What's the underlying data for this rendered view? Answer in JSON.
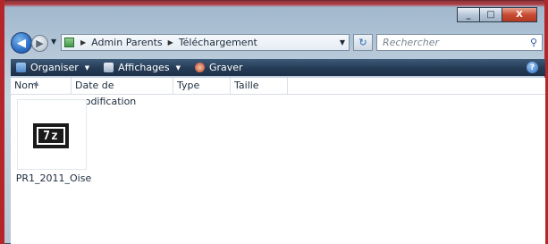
{
  "window": {
    "caption_buttons": {
      "minimize": "_",
      "maximize": "□",
      "close": "X"
    }
  },
  "address": {
    "crumbs": [
      "Admin Parents",
      "Téléchargement"
    ],
    "search_placeholder": "Rechercher"
  },
  "toolbar": {
    "organize": "Organiser",
    "views": "Affichages",
    "burn": "Graver",
    "help": "?"
  },
  "columns": [
    "Nom",
    "Date de modification",
    "Type",
    "Taille"
  ],
  "files": [
    {
      "name": "PR1_2011_Oise",
      "icon": "7z-archive-icon",
      "icon_text": "7z"
    }
  ],
  "colors": {
    "toolbar": "#253b55",
    "accent": "#2d6fc4",
    "frame_red": "#b5262a"
  }
}
